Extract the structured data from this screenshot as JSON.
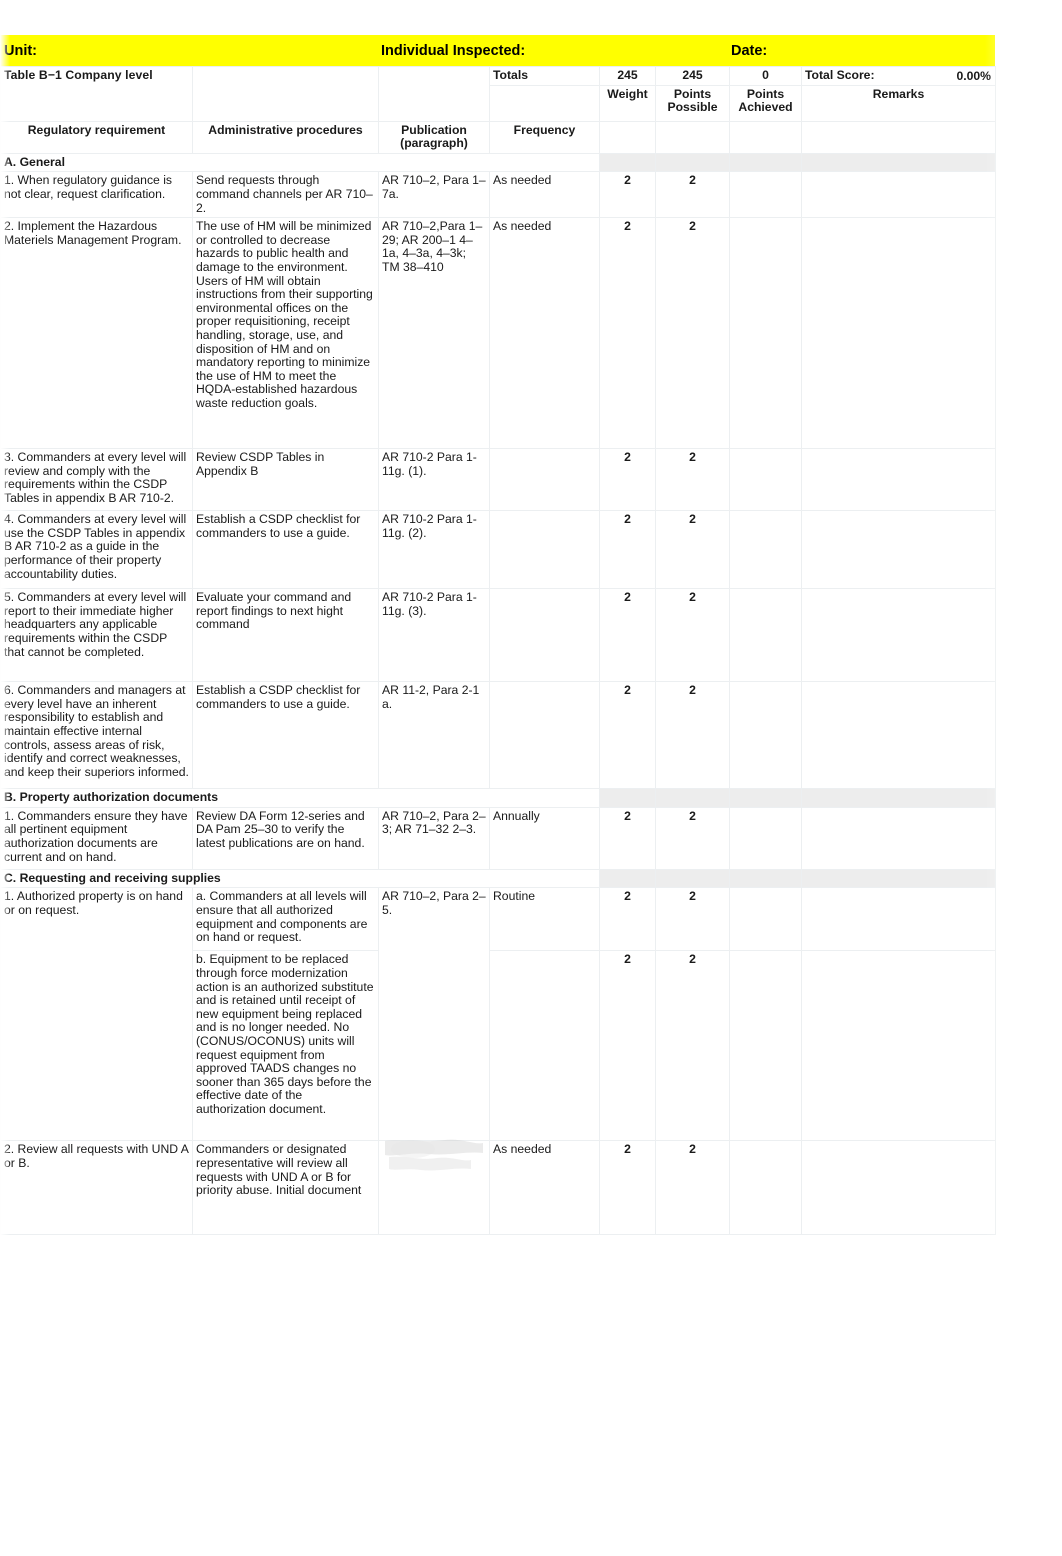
{
  "info_bar": {
    "unit_label": "Unit:",
    "individual_label": "Individual Inspected:",
    "date_label": "Date:",
    "unit_value": "",
    "individual_value": "",
    "date_value": "",
    "highlight_color": "#ffff00"
  },
  "title": "Table B−1 Company level",
  "totals": {
    "label": "Totals",
    "weight": "245",
    "points_possible": "245",
    "points_achieved": "0",
    "total_score_label": "Total Score:",
    "total_score_value": "0.00%"
  },
  "columns": {
    "regulatory_requirement": "Regulatory requirement",
    "administrative_procedures": "Administrative procedures",
    "publication": "Publication\n(paragraph)",
    "publication_line1": "Publication",
    "publication_line2": "(paragraph)",
    "frequency": "Frequency",
    "weight": "Weight",
    "points_possible_line1": "Points",
    "points_possible_line2": "Possible",
    "points_achieved_line1": "Points",
    "points_achieved_line2": "Achieved",
    "remarks": "Remarks"
  },
  "sections": [
    {
      "heading": "A. General",
      "rows": [
        {
          "requirement": "1. When regulatory guidance is not clear, request clarification.",
          "procedure": "Send requests through command channels per AR 710–2.",
          "publication": "AR 710–2, Para 1–7a.",
          "frequency": "As needed",
          "weight": "2",
          "points_possible": "2",
          "points_achieved": "",
          "remarks": ""
        },
        {
          "requirement": "2. Implement the Hazardous Materiels Management Program.",
          "procedure": "The use of HM will be minimized or controlled to decrease hazards to public health and damage to the environment. Users of HM will obtain instructions from their supporting environmental offices on the proper requisitioning, receipt handling, storage, use, and disposition of HM and on mandatory reporting to minimize the use of HM to meet the HQDA-established hazardous waste reduction goals.",
          "publication": "AR 710–2,Para 1–29; AR 200–1 4–1a, 4–3a, 4–3k; TM 38–410",
          "frequency": "As needed",
          "weight": "2",
          "points_possible": "2",
          "points_achieved": "",
          "remarks": ""
        },
        {
          "requirement": "3.  Commanders at every level will review and comply with the requirements within the CSDP Tables in appendix B AR 710-2.",
          "procedure": "Review CSDP Tables in Appendix B",
          "publication": "AR 710-2 Para 1-11g. (1).",
          "frequency": "",
          "weight": "2",
          "points_possible": "2",
          "points_achieved": "",
          "remarks": ""
        },
        {
          "requirement": "4.  Commanders at every level will use the CSDP Tables in appendix B AR 710-2 as a guide in the performance of their property accountability duties.",
          "procedure": "Establish a CSDP checklist for commanders to use a guide.",
          "publication": "AR 710-2 Para 1-11g. (2).",
          "frequency": "",
          "weight": "2",
          "points_possible": "2",
          "points_achieved": "",
          "remarks": ""
        },
        {
          "requirement": "5.  Commanders at every level will report to their immediate higher headquarters any applicable requirements within the CSDP that cannot be completed.",
          "procedure": "Evaluate your command and report findings to next hight command",
          "publication": "AR 710-2 Para 1-11g. (3).",
          "frequency": "",
          "weight": "2",
          "points_possible": "2",
          "points_achieved": "",
          "remarks": ""
        },
        {
          "requirement": "6.  Commanders and managers at every level have an inherent responsibility to establish and maintain effective internal controls, assess areas of risk, identify and correct weaknesses, and keep their superiors informed.",
          "procedure": "Establish a CSDP checklist for commanders to use a guide.",
          "publication": "AR 11-2, Para 2-1 a.",
          "frequency": "",
          "weight": "2",
          "points_possible": "2",
          "points_achieved": "",
          "remarks": ""
        }
      ]
    },
    {
      "heading": "B. Property authorization documents",
      "rows": [
        {
          "requirement": "1. Commanders ensure they have all pertinent equipment authorization documents are current and on hand.",
          "procedure": "Review DA Form 12-series and DA Pam 25–30 to verify the latest publications are on hand.",
          "publication": "AR 710–2, Para 2–3; AR 71–32 2–3.",
          "frequency": "Annually",
          "weight": "2",
          "points_possible": "2",
          "points_achieved": "",
          "remarks": ""
        }
      ]
    },
    {
      "heading": "C. Requesting and receiving supplies",
      "rows": [
        {
          "requirement": "1. Authorized property is on hand or on request.",
          "procedure": "a. Commanders at all levels will ensure that all authorized equipment and components are on hand or request.",
          "publication": "AR 710–2, Para 2–5.",
          "frequency": "Routine",
          "weight": "2",
          "points_possible": "2",
          "points_achieved": "",
          "remarks": ""
        },
        {
          "requirement": "",
          "procedure": "b. Equipment to be replaced through force modernization action is an authorized substitute and is retained until receipt of new equipment being replaced and is no longer needed. No (CONUS/OCONUS) units will request equipment from approved TAADS changes no sooner than 365 days before the effective date of the authorization document.",
          "publication": "",
          "frequency": "",
          "weight": "2",
          "points_possible": "2",
          "points_achieved": "",
          "remarks": ""
        },
        {
          "requirement": "2. Review all requests with UND A or B.",
          "procedure": "Commanders or designated representative will review all requests with UND A or B for priority abuse. Initial document",
          "publication": "",
          "frequency": "As needed",
          "weight": "2",
          "points_possible": "2",
          "points_achieved": "",
          "remarks": ""
        }
      ]
    }
  ]
}
